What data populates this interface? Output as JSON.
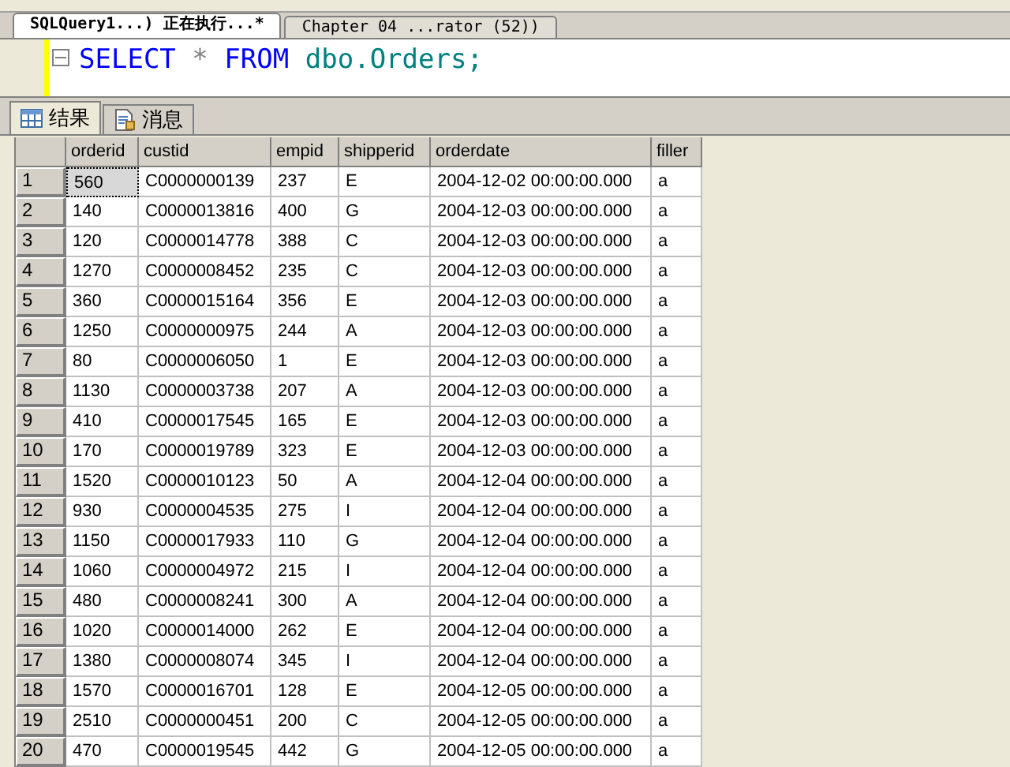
{
  "document_tabs": [
    {
      "label": "SQLQuery1...) 正在执行...*",
      "selected": true
    },
    {
      "label": "Chapter 04 ...rator (52))",
      "selected": false
    }
  ],
  "editor": {
    "tokens": [
      {
        "text": "SELECT",
        "kind": "keyword"
      },
      {
        "text": "*",
        "kind": "operator"
      },
      {
        "text": "FROM",
        "kind": "keyword"
      },
      {
        "text": "dbo.Orders;",
        "kind": "identifier"
      }
    ]
  },
  "result_tabs": [
    {
      "label": "结果",
      "kind": "grid",
      "selected": true
    },
    {
      "label": "消息",
      "kind": "messages",
      "selected": false
    }
  ],
  "table": {
    "columns": [
      "orderid",
      "custid",
      "empid",
      "shipperid",
      "orderdate",
      "filler"
    ],
    "rows": [
      {
        "number": "1",
        "selected": true,
        "cells": [
          "560",
          "C0000000139",
          "237",
          "E",
          "2004-12-02 00:00:00.000",
          "a"
        ]
      },
      {
        "number": "2",
        "selected": false,
        "cells": [
          "140",
          "C0000013816",
          "400",
          "G",
          "2004-12-03 00:00:00.000",
          "a"
        ]
      },
      {
        "number": "3",
        "selected": false,
        "cells": [
          "120",
          "C0000014778",
          "388",
          "C",
          "2004-12-03 00:00:00.000",
          "a"
        ]
      },
      {
        "number": "4",
        "selected": false,
        "cells": [
          "1270",
          "C0000008452",
          "235",
          "C",
          "2004-12-03 00:00:00.000",
          "a"
        ]
      },
      {
        "number": "5",
        "selected": false,
        "cells": [
          "360",
          "C0000015164",
          "356",
          "E",
          "2004-12-03 00:00:00.000",
          "a"
        ]
      },
      {
        "number": "6",
        "selected": false,
        "cells": [
          "1250",
          "C0000000975",
          "244",
          "A",
          "2004-12-03 00:00:00.000",
          "a"
        ]
      },
      {
        "number": "7",
        "selected": false,
        "cells": [
          "80",
          "C0000006050",
          "1",
          "E",
          "2004-12-03 00:00:00.000",
          "a"
        ]
      },
      {
        "number": "8",
        "selected": false,
        "cells": [
          "1130",
          "C0000003738",
          "207",
          "A",
          "2004-12-03 00:00:00.000",
          "a"
        ]
      },
      {
        "number": "9",
        "selected": false,
        "cells": [
          "410",
          "C0000017545",
          "165",
          "E",
          "2004-12-03 00:00:00.000",
          "a"
        ]
      },
      {
        "number": "10",
        "selected": false,
        "cells": [
          "170",
          "C0000019789",
          "323",
          "E",
          "2004-12-03 00:00:00.000",
          "a"
        ]
      },
      {
        "number": "11",
        "selected": false,
        "cells": [
          "1520",
          "C0000010123",
          "50",
          "A",
          "2004-12-04 00:00:00.000",
          "a"
        ]
      },
      {
        "number": "12",
        "selected": false,
        "cells": [
          "930",
          "C0000004535",
          "275",
          "I",
          "2004-12-04 00:00:00.000",
          "a"
        ]
      },
      {
        "number": "13",
        "selected": false,
        "cells": [
          "1150",
          "C0000017933",
          "110",
          "G",
          "2004-12-04 00:00:00.000",
          "a"
        ]
      },
      {
        "number": "14",
        "selected": false,
        "cells": [
          "1060",
          "C0000004972",
          "215",
          "I",
          "2004-12-04 00:00:00.000",
          "a"
        ]
      },
      {
        "number": "15",
        "selected": false,
        "cells": [
          "480",
          "C0000008241",
          "300",
          "A",
          "2004-12-04 00:00:00.000",
          "a"
        ]
      },
      {
        "number": "16",
        "selected": false,
        "cells": [
          "1020",
          "C0000014000",
          "262",
          "E",
          "2004-12-04 00:00:00.000",
          "a"
        ]
      },
      {
        "number": "17",
        "selected": false,
        "cells": [
          "1380",
          "C0000008074",
          "345",
          "I",
          "2004-12-04 00:00:00.000",
          "a"
        ]
      },
      {
        "number": "18",
        "selected": false,
        "cells": [
          "1570",
          "C0000016701",
          "128",
          "E",
          "2004-12-05 00:00:00.000",
          "a"
        ]
      },
      {
        "number": "19",
        "selected": false,
        "cells": [
          "2510",
          "C0000000451",
          "200",
          "C",
          "2004-12-05 00:00:00.000",
          "a"
        ]
      },
      {
        "number": "20",
        "selected": false,
        "cells": [
          "470",
          "C0000019545",
          "442",
          "G",
          "2004-12-05 00:00:00.000",
          "a"
        ]
      }
    ]
  }
}
